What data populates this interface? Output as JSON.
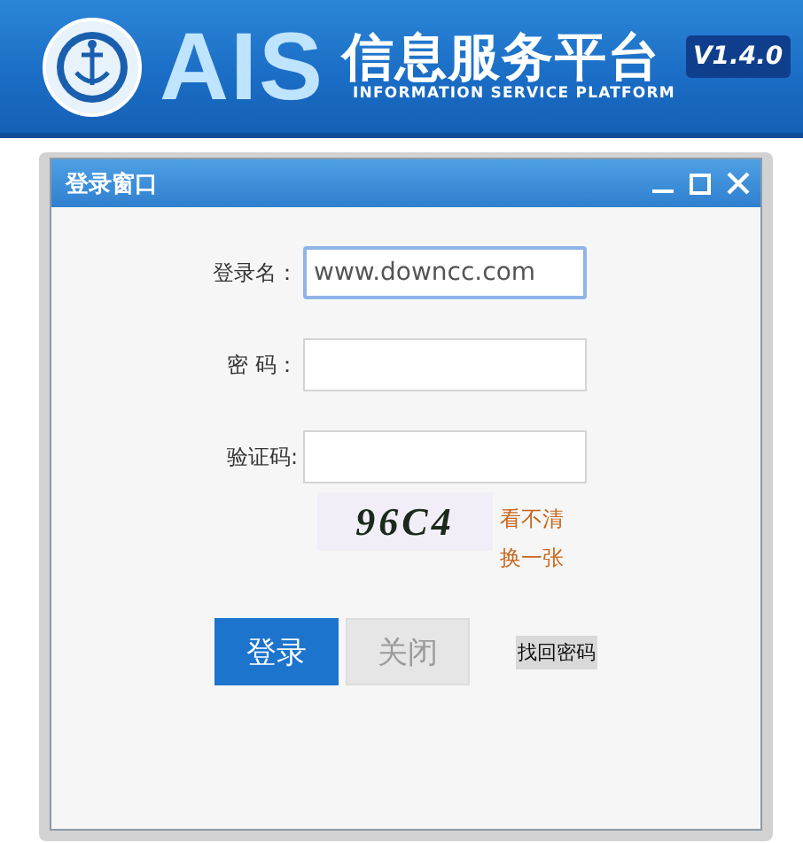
{
  "header": {
    "brand": "AIS",
    "title": "信息服务平台",
    "subtitle": "INFORMATION SERVICE PLATFORM",
    "version": "V1.4.0"
  },
  "window": {
    "title": "登录窗口"
  },
  "fields": [
    {
      "label": "登录名：",
      "value": "www.downcc.com",
      "focused": true
    },
    {
      "label": "密 码：",
      "focused": false
    },
    {
      "label": "验证码:",
      "focused": false
    }
  ],
  "captcha": {
    "code": "96C4",
    "links": [
      "看不清",
      "换一张"
    ]
  },
  "buttons": [
    {
      "label": "登录",
      "kind": "primary"
    },
    {
      "label": "关闭",
      "kind": "secondary"
    }
  ],
  "recover_link": "找回密码"
}
